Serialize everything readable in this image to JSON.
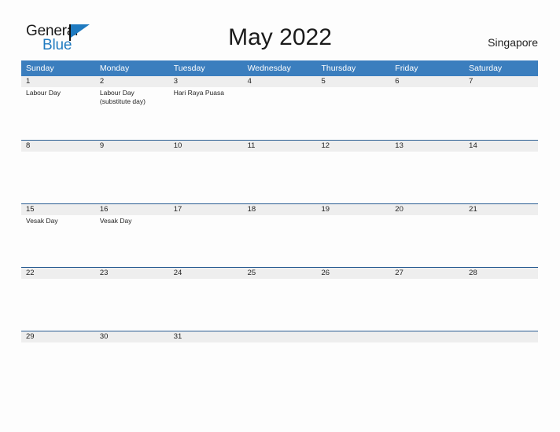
{
  "header": {
    "logo": {
      "word_one": "General",
      "word_two": "Blue",
      "triangle_icon": "triangle-icon",
      "brand_color": "#1f7ac0"
    },
    "title": "May 2022",
    "region": "Singapore"
  },
  "calendar": {
    "accent_color": "#3b7ebe",
    "row_border_color": "#2a5d92",
    "date_band_color": "#eeeeee",
    "day_names": [
      "Sunday",
      "Monday",
      "Tuesday",
      "Wednesday",
      "Thursday",
      "Friday",
      "Saturday"
    ],
    "weeks": [
      [
        {
          "date": "1",
          "events": [
            "Labour Day"
          ]
        },
        {
          "date": "2",
          "events": [
            "Labour Day (substitute day)"
          ]
        },
        {
          "date": "3",
          "events": [
            "Hari Raya Puasa"
          ]
        },
        {
          "date": "4",
          "events": []
        },
        {
          "date": "5",
          "events": []
        },
        {
          "date": "6",
          "events": []
        },
        {
          "date": "7",
          "events": []
        }
      ],
      [
        {
          "date": "8",
          "events": []
        },
        {
          "date": "9",
          "events": []
        },
        {
          "date": "10",
          "events": []
        },
        {
          "date": "11",
          "events": []
        },
        {
          "date": "12",
          "events": []
        },
        {
          "date": "13",
          "events": []
        },
        {
          "date": "14",
          "events": []
        }
      ],
      [
        {
          "date": "15",
          "events": [
            "Vesak Day"
          ]
        },
        {
          "date": "16",
          "events": [
            "Vesak Day"
          ]
        },
        {
          "date": "17",
          "events": []
        },
        {
          "date": "18",
          "events": []
        },
        {
          "date": "19",
          "events": []
        },
        {
          "date": "20",
          "events": []
        },
        {
          "date": "21",
          "events": []
        }
      ],
      [
        {
          "date": "22",
          "events": []
        },
        {
          "date": "23",
          "events": []
        },
        {
          "date": "24",
          "events": []
        },
        {
          "date": "25",
          "events": []
        },
        {
          "date": "26",
          "events": []
        },
        {
          "date": "27",
          "events": []
        },
        {
          "date": "28",
          "events": []
        }
      ],
      [
        {
          "date": "29",
          "events": []
        },
        {
          "date": "30",
          "events": []
        },
        {
          "date": "31",
          "events": []
        },
        {
          "date": "",
          "events": []
        },
        {
          "date": "",
          "events": []
        },
        {
          "date": "",
          "events": []
        },
        {
          "date": "",
          "events": []
        }
      ]
    ]
  }
}
